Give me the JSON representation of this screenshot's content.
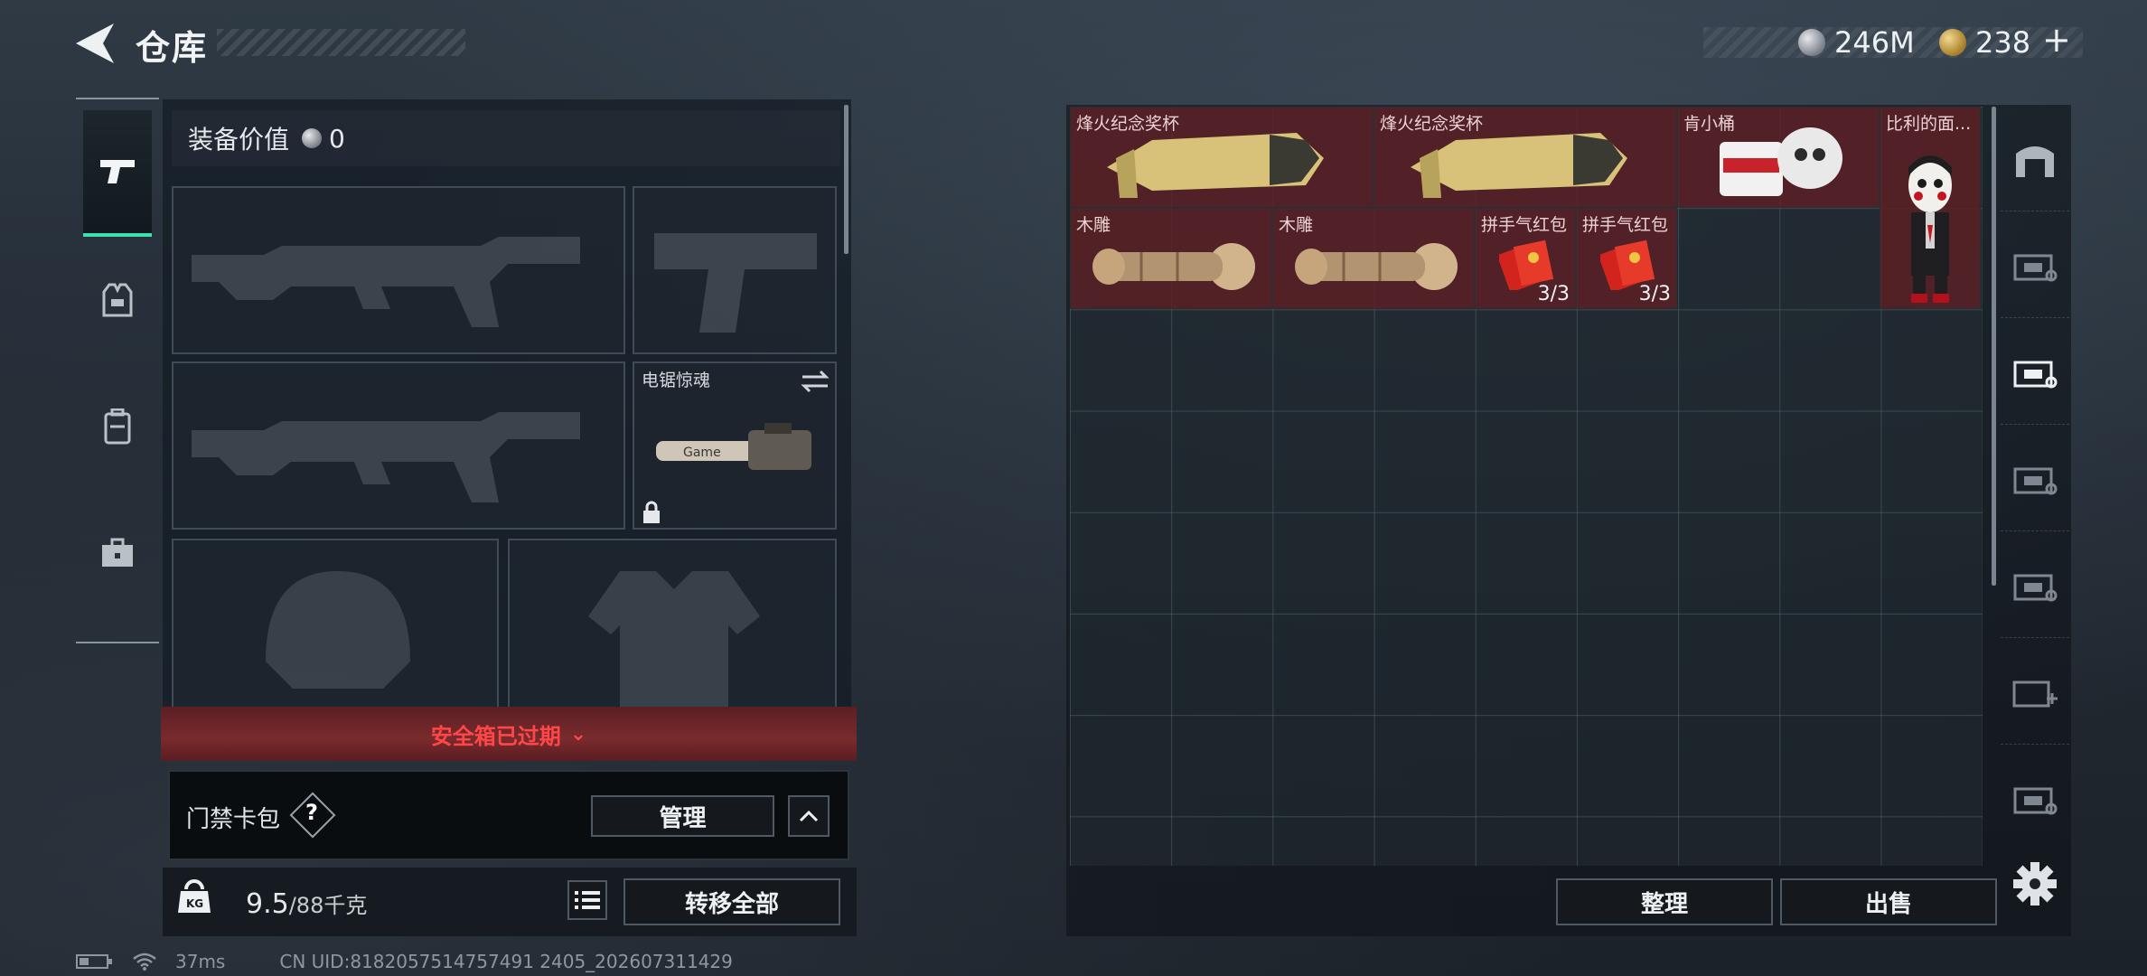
{
  "header": {
    "title": "仓库"
  },
  "currency": {
    "silver": "246M",
    "gold": "238",
    "plus": "+"
  },
  "equipment": {
    "value_label": "装备价值",
    "value": "0",
    "melee_name": "电锯惊魂"
  },
  "safe_box": {
    "label": "安全箱已过期"
  },
  "keycard": {
    "label": "门禁卡包",
    "help": "?",
    "manage": "管理",
    "collapse": "^"
  },
  "weight": {
    "current": "9.5",
    "max": "/88千克"
  },
  "transfer": {
    "label": "转移全部"
  },
  "items": [
    {
      "name": "烽火纪念奖杯",
      "count": ""
    },
    {
      "name": "烽火纪念奖杯",
      "count": ""
    },
    {
      "name": "肯小桶",
      "count": ""
    },
    {
      "name": "比利的面...",
      "count": ""
    },
    {
      "name": "木雕",
      "count": ""
    },
    {
      "name": "木雕",
      "count": ""
    },
    {
      "name": "拼手气红包",
      "count": "3/3"
    },
    {
      "name": "拼手气红包",
      "count": "3/3"
    }
  ],
  "actions": {
    "sort": "整理",
    "sell": "出售"
  },
  "status": {
    "ping": "37ms",
    "uid": "CN UID:8182057514757491 2405_202607311429"
  },
  "colors": {
    "accent": "#3fe0b0",
    "item_bg": "#5c2024",
    "danger": "#ff4747"
  },
  "icons": {
    "back": "back-arrow-icon",
    "settings": "gear-icon"
  }
}
